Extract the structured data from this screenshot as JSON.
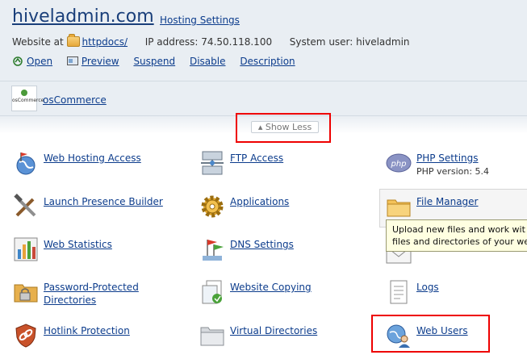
{
  "header": {
    "domain": "hiveladmin.com",
    "hosting_settings": "Hosting Settings",
    "website_at_label": "Website at",
    "website_path": "httpdocs/",
    "ip_label": "IP address:",
    "ip_value": "74.50.118.100",
    "system_user_label": "System user:",
    "system_user_value": "hiveladmin",
    "actions": [
      "Open",
      "Preview",
      "Suspend",
      "Disable",
      "Description"
    ]
  },
  "apps": {
    "oscommerce_logo_text": "osCommerce",
    "oscommerce_label": "osCommerce"
  },
  "show_less": "Show Less",
  "grid": {
    "web_hosting_access": "Web Hosting Access",
    "ftp_access": "FTP Access",
    "php_settings": "PHP Settings",
    "php_version": "PHP version: 5.4",
    "launch_presence_builder": "Launch Presence Builder",
    "applications": "Applications",
    "file_manager": "File Manager",
    "web_statistics": "Web Statistics",
    "dns_settings": "DNS Settings",
    "password_protected_line1": "Password-Protected",
    "password_protected_line2": "Directories",
    "website_copying": "Website Copying",
    "logs": "Logs",
    "hotlink_protection": "Hotlink Protection",
    "virtual_directories": "Virtual Directories",
    "web_users": "Web Users"
  },
  "tooltip": {
    "line1": "Upload new files and work wit",
    "line2": "files and directories of your we"
  },
  "icons": {
    "open": "open-icon",
    "preview": "preview-icon",
    "web_hosting_access": "globe-flag-icon",
    "ftp_access": "ftp-network-icon",
    "php_settings": "php-icon",
    "launch_presence_builder": "tools-icon",
    "applications": "gear-icon",
    "file_manager": "folder-icon",
    "web_statistics": "bar-chart-icon",
    "dns_settings": "dns-flags-icon",
    "mail": "envelope-icon",
    "password_protected": "locked-folder-icon",
    "website_copying": "copy-pages-icon",
    "logs": "log-document-icon",
    "hotlink_protection": "shield-link-icon",
    "virtual_directories": "folder-stack-icon",
    "web_users": "globe-user-icon"
  }
}
